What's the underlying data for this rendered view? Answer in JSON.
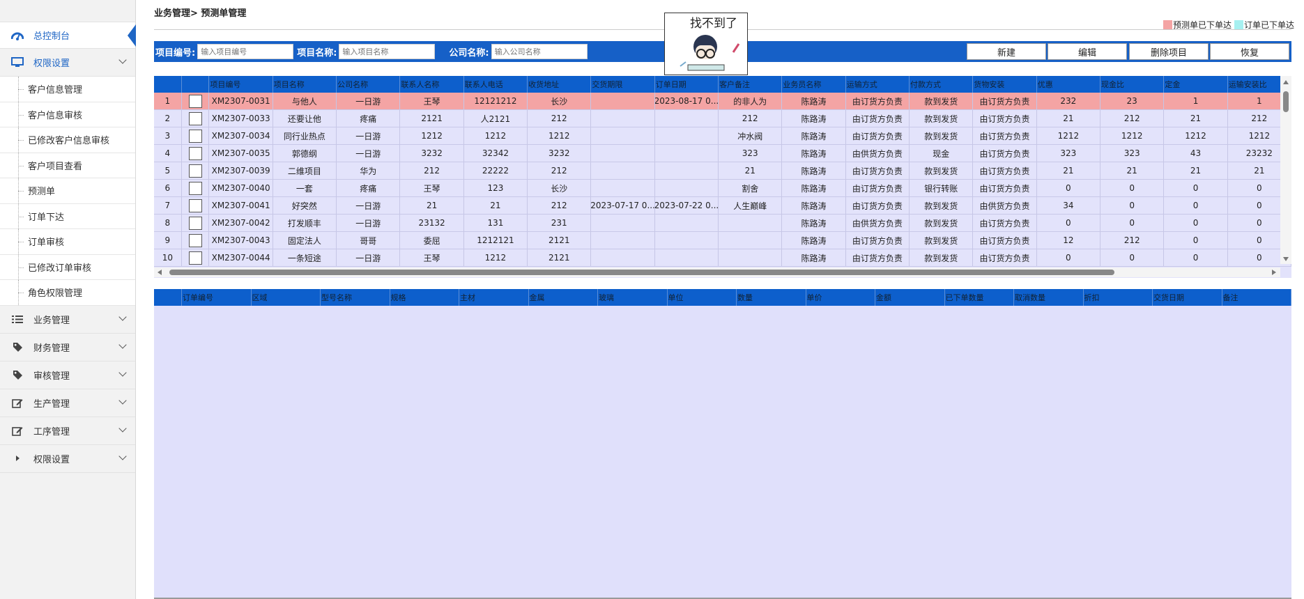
{
  "sidebar": {
    "dashboard": "总控制台",
    "perm_open": "权限设置",
    "sub_items": [
      "客户信息管理",
      "客户信息审核",
      "已修改客户信息审核",
      "客户项目查看",
      "预测单",
      "订单下达",
      "订单审核",
      "已修改订单审核",
      "角色权限管理"
    ],
    "groups": [
      {
        "label": "业务管理",
        "icon": "list-icon"
      },
      {
        "label": "财务管理",
        "icon": "tag-icon"
      },
      {
        "label": "审核管理",
        "icon": "tag-icon"
      },
      {
        "label": "生产管理",
        "icon": "edit-icon"
      },
      {
        "label": "工序管理",
        "icon": "edit-icon"
      },
      {
        "label": "权限设置",
        "icon": "caret-right-icon"
      }
    ]
  },
  "breadcrumb": "业务管理> 预测单管理",
  "legend": [
    {
      "label": "预测单已下单达",
      "color": "#f4a4a4"
    },
    {
      "label": "订单已下单达",
      "color": "#a6f0f0"
    }
  ],
  "filter": {
    "code_label": "项目编号:",
    "code_placeholder": "输入项目编号",
    "name_label": "项目名称:",
    "name_placeholder": "输入项目名称",
    "company_label": "公司名称:",
    "company_placeholder": "输入公司名称"
  },
  "buttons": {
    "new": "新建",
    "edit": "编辑",
    "delete": "删除项目",
    "restore": "恢复"
  },
  "mascot_text": "找不到了",
  "upper_table": {
    "columns": [
      "项目编号",
      "项目名称",
      "公司名称",
      "联系人名称",
      "联系人电话",
      "收货地址",
      "交货期限",
      "订单日期",
      "客户备注",
      "业务员名称",
      "运输方式",
      "付款方式",
      "货物安装",
      "优惠",
      "现金比",
      "定金",
      "运输安装比"
    ],
    "rows": [
      [
        "1",
        "XM2307-0031",
        "与他人",
        "一日游",
        "王琴",
        "12121212",
        "长沙",
        "",
        "2023-08-17 0...",
        "的非人为",
        "陈路涛",
        "由订货方负责",
        "款到发货",
        "由订货方负责",
        "232",
        "23",
        "1",
        "1"
      ],
      [
        "2",
        "XM2307-0033",
        "还要让他",
        "疼痛",
        "2121",
        "人2121",
        "212",
        "",
        "",
        "212",
        "陈路涛",
        "由订货方负责",
        "款到发货",
        "由订货方负责",
        "21",
        "212",
        "21",
        "212"
      ],
      [
        "3",
        "XM2307-0034",
        "同行业热点",
        "一日游",
        "1212",
        "1212",
        "1212",
        "",
        "",
        "冲水阀",
        "陈路涛",
        "由订货方负责",
        "款到发货",
        "由订货方负责",
        "1212",
        "1212",
        "1212",
        "1212"
      ],
      [
        "4",
        "XM2307-0035",
        "郭德纲",
        "一日游",
        "3232",
        "32342",
        "3232",
        "",
        "",
        "323",
        "陈路涛",
        "由供货方负责",
        "现金",
        "由订货方负责",
        "323",
        "323",
        "43",
        "23232"
      ],
      [
        "5",
        "XM2307-0039",
        "二维项目",
        "华为",
        "212",
        "22222",
        "212",
        "",
        "",
        "21",
        "陈路涛",
        "由订货方负责",
        "款到发货",
        "由订货方负责",
        "21",
        "21",
        "21",
        "21"
      ],
      [
        "6",
        "XM2307-0040",
        "一套",
        "疼痛",
        "王琴",
        "123",
        "长沙",
        "",
        "",
        "割舍",
        "陈路涛",
        "由订货方负责",
        "银行转账",
        "由订货方负责",
        "0",
        "0",
        "0",
        "0"
      ],
      [
        "7",
        "XM2307-0041",
        "好突然",
        "一日游",
        "21",
        "21",
        "212",
        "2023-07-17 0...",
        "2023-07-22 0...",
        "人生巅峰",
        "陈路涛",
        "由订货方负责",
        "款到发货",
        "由供货方负责",
        "34",
        "0",
        "0",
        "0"
      ],
      [
        "8",
        "XM2307-0042",
        "打发顺丰",
        "一日游",
        "23132",
        "131",
        "231",
        "",
        "",
        "",
        "陈路涛",
        "由供货方负责",
        "款到发货",
        "由订货方负责",
        "0",
        "0",
        "0",
        "0"
      ],
      [
        "9",
        "XM2307-0043",
        "固定法人",
        "哥哥",
        "委屈",
        "1212121",
        "2121",
        "",
        "",
        "",
        "陈路涛",
        "由订货方负责",
        "款到发货",
        "由订货方负责",
        "12",
        "212",
        "0",
        "0"
      ],
      [
        "10",
        "XM2307-0044",
        "一条短途",
        "一日游",
        "王琴",
        "1212",
        "2121",
        "",
        "",
        "",
        "陈路涛",
        "由订货方负责",
        "款到发货",
        "由订货方负责",
        "0",
        "0",
        "0",
        "0"
      ]
    ]
  },
  "lower_table": {
    "columns": [
      "订单编号",
      "区域",
      "型号名称",
      "规格",
      "主材",
      "金属",
      "玻璃",
      "单位",
      "数量",
      "单价",
      "金额",
      "已下单数量",
      "取消数量",
      "折扣",
      "交货日期",
      "备注"
    ]
  }
}
